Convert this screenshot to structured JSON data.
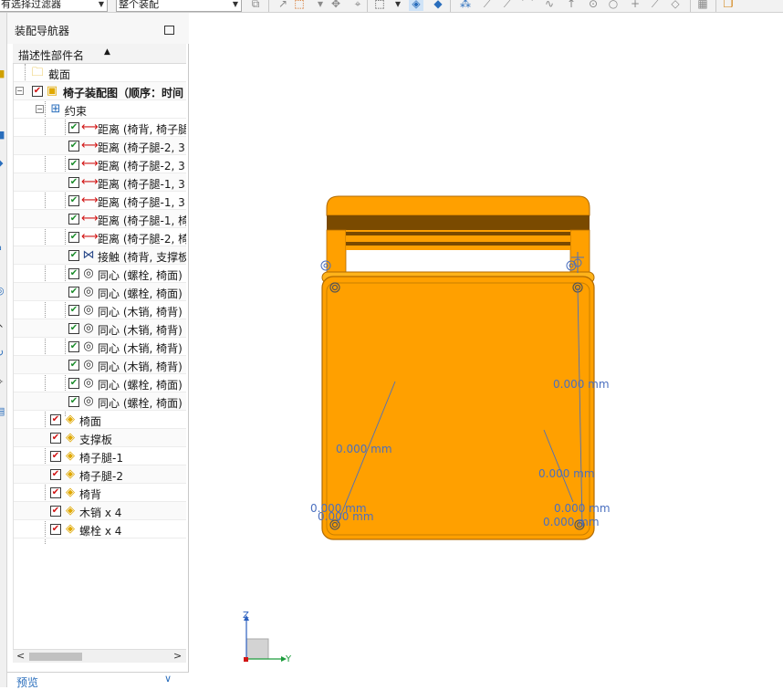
{
  "toolbar": {
    "filter_combo": "有选择过滤器",
    "scope_combo": "整个装配"
  },
  "navigator": {
    "title": "装配导航器",
    "column_header": "描述性部件名",
    "sort_indicator": "▲",
    "preview_label": "预览"
  },
  "tree": {
    "section": "截面",
    "assembly": "椅子装配图（顺序：时间",
    "constraints_group": "约束",
    "constraints": [
      {
        "type": "distance",
        "label": "距离 (椅背, 椅子腿"
      },
      {
        "type": "distance",
        "label": "距离 (椅子腿-2, 3"
      },
      {
        "type": "distance",
        "label": "距离 (椅子腿-2, 3"
      },
      {
        "type": "distance",
        "label": "距离 (椅子腿-1, 3"
      },
      {
        "type": "distance",
        "label": "距离 (椅子腿-1, 3"
      },
      {
        "type": "distance",
        "label": "距离 (椅子腿-1, 椅"
      },
      {
        "type": "distance",
        "label": "距离 (椅子腿-2, 椅"
      },
      {
        "type": "touch",
        "label": "接触 (椅背, 支撑板"
      },
      {
        "type": "concentric",
        "label": "同心 (螺栓, 椅面)"
      },
      {
        "type": "concentric",
        "label": "同心 (螺栓, 椅面)"
      },
      {
        "type": "concentric",
        "label": "同心 (木销, 椅背)"
      },
      {
        "type": "concentric",
        "label": "同心 (木销, 椅背)"
      },
      {
        "type": "concentric",
        "label": "同心 (木销, 椅背)"
      },
      {
        "type": "concentric",
        "label": "同心 (木销, 椅背)"
      },
      {
        "type": "concentric",
        "label": "同心 (螺栓, 椅面)"
      },
      {
        "type": "concentric",
        "label": "同心 (螺栓, 椅面)"
      }
    ],
    "parts": [
      "椅面",
      "支撑板",
      "椅子腿-1",
      "椅子腿-2",
      "椅背",
      "木销 x 4",
      "螺栓 x 4"
    ]
  },
  "viewport": {
    "dimensions": [
      "0.000 mm",
      "0.000 mm",
      "0.000 mm",
      "0.000 mm",
      "0.000 mm",
      "0.000 mm",
      "0.000 mm"
    ],
    "axes": {
      "z": "Z",
      "y": "Y"
    }
  },
  "colors": {
    "part_orange": "#ffa000",
    "part_dark": "#7a4a00",
    "constraint_blue": "#4a6fbf",
    "check_red": "#d11515",
    "check_green": "#1c8c2c"
  }
}
